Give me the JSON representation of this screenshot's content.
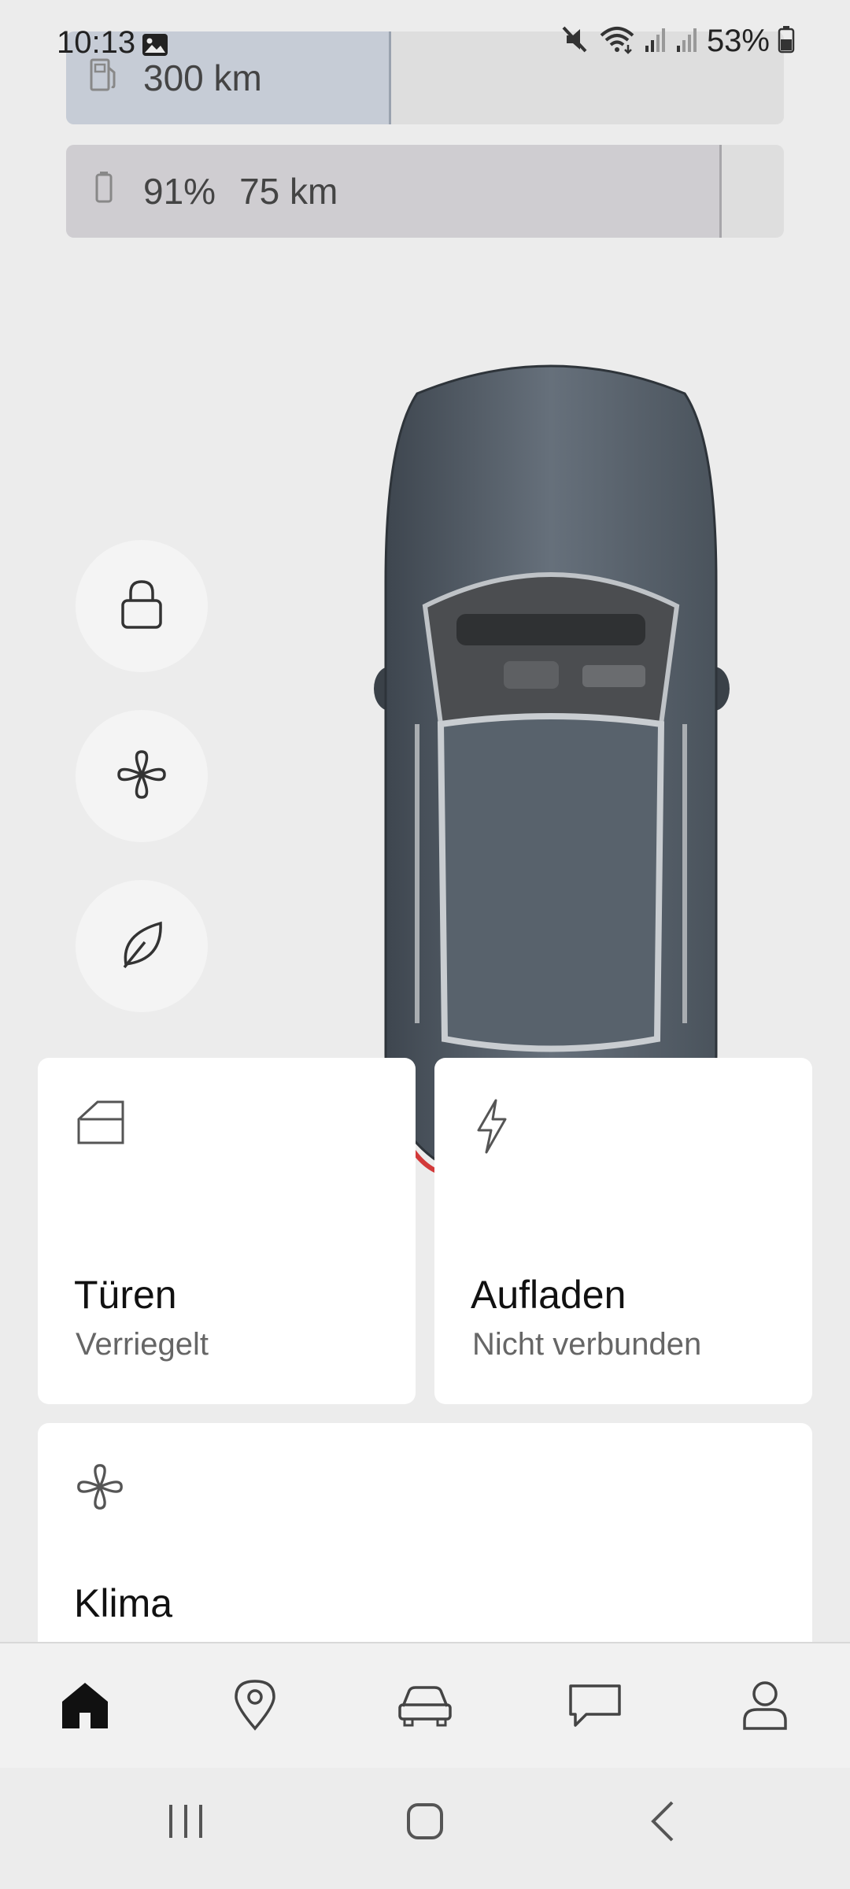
{
  "status_bar": {
    "time": "10:13",
    "battery_text": "53%",
    "icons": [
      "gallery-icon",
      "mute-icon",
      "wifi-icon",
      "signal-icon",
      "signal-icon",
      "battery-icon"
    ]
  },
  "range": {
    "fuel": {
      "value": "300 km",
      "fill_fraction": 0.45,
      "icon": "fuel-pump-icon"
    },
    "battery": {
      "percent": "91%",
      "value": "75 km",
      "fill_fraction": 0.91,
      "icon": "battery-icon"
    }
  },
  "quick_actions": [
    {
      "name": "lock",
      "icon": "lock-icon"
    },
    {
      "name": "climate",
      "icon": "fan-icon"
    },
    {
      "name": "eco",
      "icon": "leaf-icon"
    }
  ],
  "cards": {
    "doors": {
      "title": "Türen",
      "subtitle": "Verriegelt",
      "icon": "door-icon"
    },
    "charging": {
      "title": "Aufladen",
      "subtitle": "Nicht verbunden",
      "icon": "lightning-icon"
    },
    "climate": {
      "title": "Klima",
      "icon": "fan-icon"
    }
  },
  "bottom_nav": [
    {
      "name": "home",
      "icon": "home-icon",
      "active": true
    },
    {
      "name": "map",
      "icon": "map-pin-icon",
      "active": false
    },
    {
      "name": "car",
      "icon": "car-icon",
      "active": false
    },
    {
      "name": "messages",
      "icon": "chat-icon",
      "active": false
    },
    {
      "name": "profile",
      "icon": "person-icon",
      "active": false
    }
  ],
  "colors": {
    "background": "#ececec",
    "card": "#ffffff",
    "car_body": "#5c6670",
    "fuel_fill": "#c6ccd6",
    "battery_fill": "#cfcdd1"
  }
}
